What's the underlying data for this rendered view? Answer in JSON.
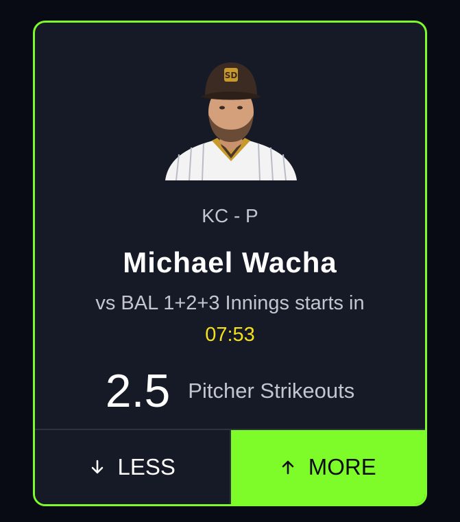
{
  "colors": {
    "page_bg": "#080b14",
    "card_bg": "#161a26",
    "accent": "#7dfc2a",
    "countdown": "#f5e11b",
    "muted_text": "#c3c6ce"
  },
  "player": {
    "team_position": "KC - P",
    "name": "Michael Wacha",
    "photo_icon": "player-headshot",
    "cap_logo_icon": "padres-sd-logo"
  },
  "matchup": {
    "text": "vs BAL 1+2+3 Innings starts in",
    "countdown": "07:53"
  },
  "projection": {
    "line": "2.5",
    "stat": "Pitcher Strikeouts"
  },
  "buttons": {
    "less": {
      "label": "LESS",
      "icon": "arrow-down-icon"
    },
    "more": {
      "label": "MORE",
      "icon": "arrow-up-icon"
    }
  }
}
